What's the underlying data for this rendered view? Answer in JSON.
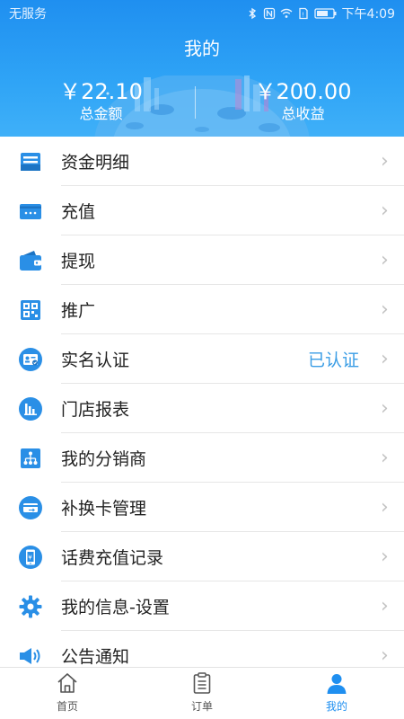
{
  "statusbar": {
    "carrier": "无服务",
    "time": "下午4:09",
    "icons": [
      "bluetooth-icon",
      "nfc-icon",
      "wifi-icon",
      "sim-icon",
      "battery-icon"
    ]
  },
  "header": {
    "title": "我的"
  },
  "summary": {
    "total_amount": "￥22.10",
    "total_amount_label": "总金额",
    "total_income": "￥200.00",
    "total_income_label": "总收益"
  },
  "menu": {
    "items": [
      {
        "label": "资金明细",
        "icon": "funds-detail-icon"
      },
      {
        "label": "充值",
        "icon": "recharge-card-icon"
      },
      {
        "label": "提现",
        "icon": "wallet-icon"
      },
      {
        "label": "推广",
        "icon": "qr-code-icon"
      },
      {
        "label": "实名认证",
        "icon": "id-card-icon",
        "status": "已认证"
      },
      {
        "label": "门店报表",
        "icon": "bar-chart-icon"
      },
      {
        "label": "我的分销商",
        "icon": "org-chart-icon"
      },
      {
        "label": "补换卡管理",
        "icon": "card-exchange-icon"
      },
      {
        "label": "话费充值记录",
        "icon": "phone-bill-icon"
      },
      {
        "label": "我的信息-设置",
        "icon": "gear-icon"
      },
      {
        "label": "公告通知",
        "icon": "speaker-icon"
      }
    ],
    "chevron": "›"
  },
  "tabbar": {
    "tabs": [
      {
        "label": "首页",
        "icon": "home-icon"
      },
      {
        "label": "订单",
        "icon": "clipboard-icon"
      },
      {
        "label": "我的",
        "icon": "user-icon",
        "active": true
      }
    ]
  },
  "colors": {
    "primary": "#1f8ff0",
    "icon_blue": "#2a8fe6",
    "status_blue": "#3a9de5"
  }
}
